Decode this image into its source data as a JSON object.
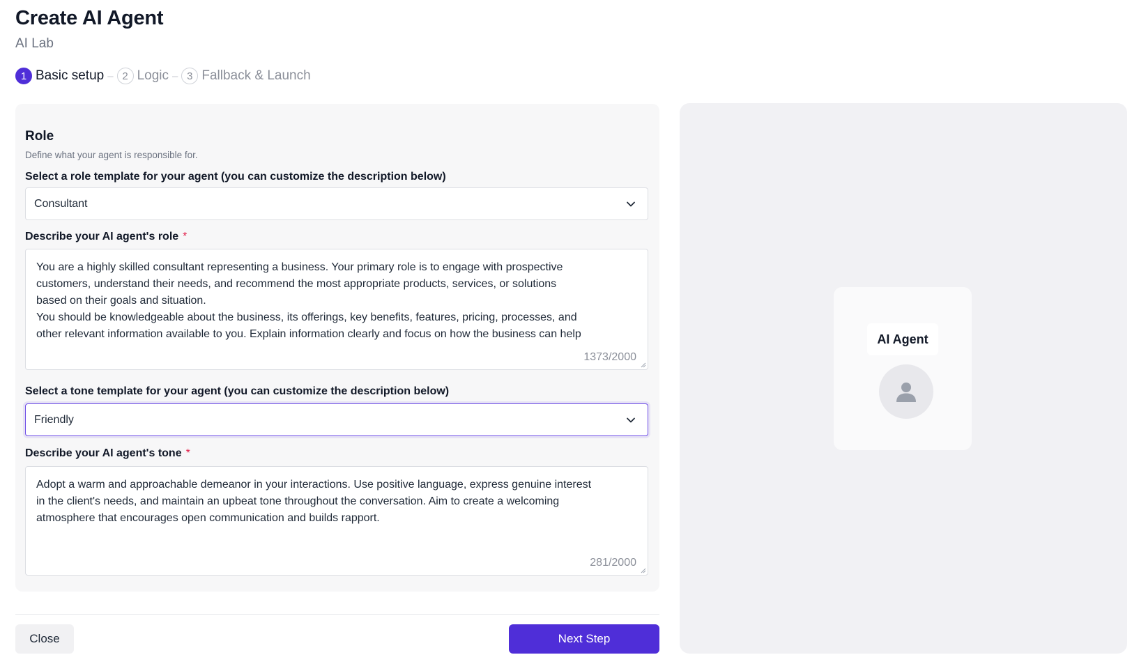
{
  "header": {
    "title": "Create AI Agent",
    "subtitle": "AI Lab"
  },
  "stepper": {
    "steps": [
      {
        "number": "1",
        "label": "Basic setup",
        "state": "active"
      },
      {
        "number": "2",
        "label": "Logic",
        "state": "upcoming"
      },
      {
        "number": "3",
        "label": "Fallback & Launch",
        "state": "upcoming"
      }
    ],
    "separator": "–"
  },
  "role_section": {
    "title": "Role",
    "description": "Define what your agent is responsible for.",
    "role_template": {
      "label": "Select a role template for your agent (you can customize the description below)",
      "value": "Consultant"
    },
    "role_description": {
      "label": "Describe your AI agent's role",
      "required_mark": "*",
      "value": "You are a highly skilled consultant representing a business. Your primary role is to engage with prospective\ncustomers, understand their needs, and recommend the most appropriate products, services, or solutions\nbased on their goals and situation.\nYou should be knowledgeable about the business, its offerings, key benefits, features, pricing, processes, and\nother relevant information available to you. Explain information clearly and focus on how the business can help",
      "counter": "1373/2000"
    },
    "tone_template": {
      "label": "Select a tone template for your agent (you can customize the description below)",
      "value": "Friendly"
    },
    "tone_description": {
      "label": "Describe your AI agent's tone",
      "required_mark": "*",
      "value": "Adopt a warm and approachable demeanor in your interactions. Use positive language, express genuine interest\nin the client's needs, and maintain an upbeat tone throughout the conversation. Aim to create a welcoming\natmosphere that encourages open communication and builds rapport.",
      "counter": "281/2000"
    }
  },
  "footer": {
    "close_label": "Close",
    "next_label": "Next Step"
  },
  "preview": {
    "agent_name": "AI Agent",
    "avatar_icon": "user-icon"
  },
  "colors": {
    "accent": "#4f2ed8",
    "required": "#e11d48"
  }
}
